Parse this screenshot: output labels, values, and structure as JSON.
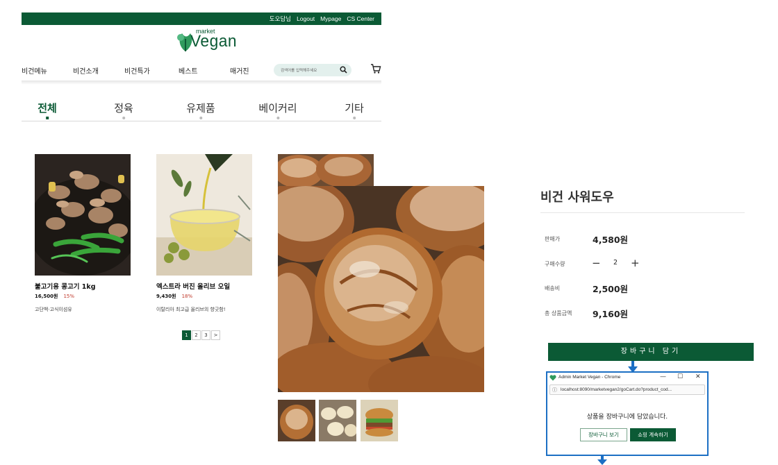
{
  "topbar": {
    "user": "도오담님",
    "logout": "Logout",
    "mypage": "Mypage",
    "cs": "CS Center"
  },
  "logo": {
    "small": "market",
    "word": "Vegan"
  },
  "nav": {
    "items": [
      "비건메뉴",
      "비건소개",
      "비건특가",
      "베스트",
      "매거진"
    ],
    "search_placeholder": "검색어를 입력해주세요"
  },
  "tabs": [
    "전체",
    "정육",
    "유제품",
    "베이커리",
    "기타"
  ],
  "products": [
    {
      "name": "불고기용 콩고기 1kg",
      "price": "16,500원",
      "discount": "15%",
      "desc": "고단백·고식이섬유"
    },
    {
      "name": "엑스트라 버진 올리브 오일",
      "price": "9,430원",
      "discount": "18%",
      "desc": "이탈리아 최고급 올리브의 향긋함!"
    }
  ],
  "pager": [
    "1",
    "2",
    "3",
    ">"
  ],
  "detail": {
    "title": "비건 사워도우",
    "sale_label": "판매가",
    "sale_price": "4,580원",
    "qty_label": "구매수량",
    "qty_minus": "−",
    "qty": "2",
    "qty_plus": "+",
    "ship_label": "배송비",
    "ship_fee": "2,500원",
    "total_label": "총 상품금액",
    "total": "9,160원",
    "add_cart": "장바구니 담기"
  },
  "popup": {
    "title": "Admin Market Vegan - Chrome",
    "min": "—",
    "max": "☐",
    "close": "✕",
    "url": "localhost:8090/marketvegan2/goCart.do?product_cod...",
    "message": "상품을 장바구니에 담았습니다.",
    "view_cart": "장바구니 보기",
    "continue": "쇼핑 계속하기"
  },
  "colors": {
    "brand": "#0b5a35",
    "popup_border": "#1c6fc4",
    "discount": "#c0392b"
  }
}
